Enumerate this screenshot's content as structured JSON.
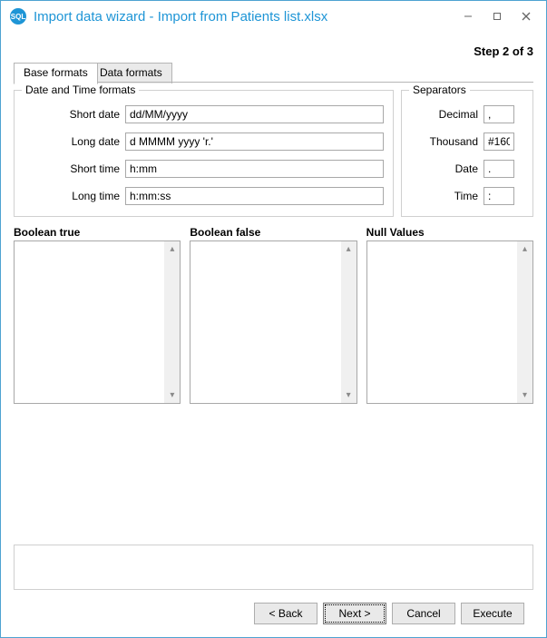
{
  "window": {
    "logo_text": "SQL",
    "title": "Import data wizard - Import from Patients list.xlsx"
  },
  "step": "Step 2 of 3",
  "tabs": {
    "base": "Base formats",
    "data": "Data formats"
  },
  "datetime": {
    "group_title": "Date and Time formats",
    "short_date_label": "Short date",
    "short_date_value": "dd/MM/yyyy",
    "long_date_label": "Long date",
    "long_date_value": "d MMMM yyyy 'r.'",
    "short_time_label": "Short time",
    "short_time_value": "h:mm",
    "long_time_label": "Long time",
    "long_time_value": "h:mm:ss"
  },
  "separators": {
    "group_title": "Separators",
    "decimal_label": "Decimal",
    "decimal_value": ",",
    "thousand_label": "Thousand",
    "thousand_value": "#160",
    "date_label": "Date",
    "date_value": ".",
    "time_label": "Time",
    "time_value": ":"
  },
  "lists": {
    "boolean_true": "Boolean true",
    "boolean_false": "Boolean false",
    "null_values": "Null Values"
  },
  "buttons": {
    "back": "< Back",
    "next": "Next >",
    "cancel": "Cancel",
    "execute": "Execute"
  }
}
